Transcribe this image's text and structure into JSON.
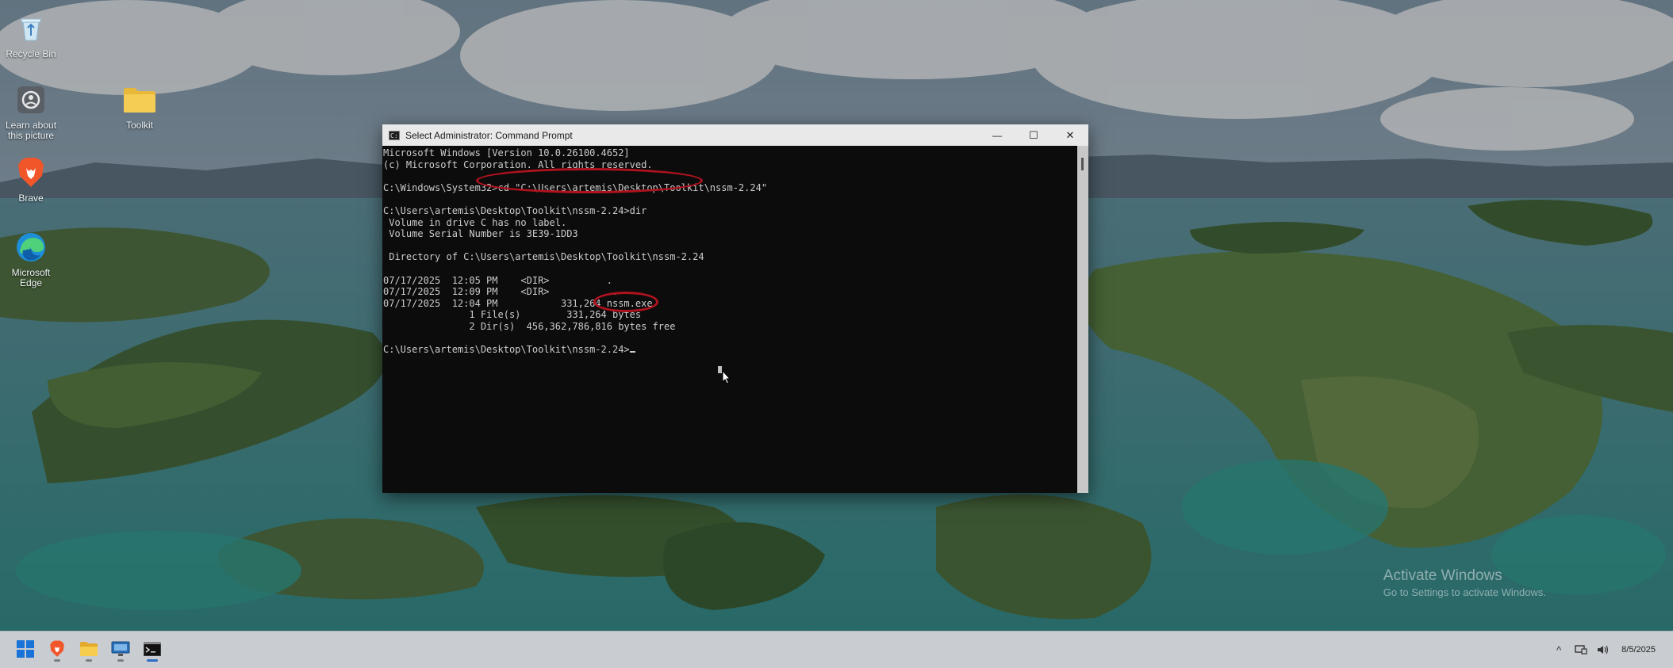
{
  "desktop": {
    "icons": [
      {
        "label": "Recycle Bin",
        "icon": "recycle-bin-icon"
      },
      {
        "label": "Learn about this picture",
        "icon": "learn-camera-icon"
      },
      {
        "label": "Toolkit",
        "icon": "folder-icon"
      },
      {
        "label": "Brave",
        "icon": "brave-lion-icon"
      },
      {
        "label": "Microsoft Edge",
        "icon": "edge-icon"
      }
    ],
    "watermark": {
      "line1": "Activate Windows",
      "line2": "Go to Settings to activate Windows."
    }
  },
  "cmd_window": {
    "title": "Select Administrator: Command Prompt",
    "controls": {
      "minimize": "—",
      "maximize": "☐",
      "close": "✕"
    },
    "lines": [
      "Microsoft Windows [Version 10.0.26100.4652]",
      "(c) Microsoft Corporation. All rights reserved.",
      "",
      "C:\\Windows\\System32>cd \"C:\\Users\\artemis\\Desktop\\Toolkit\\nssm-2.24\"",
      "",
      "C:\\Users\\artemis\\Desktop\\Toolkit\\nssm-2.24>dir",
      " Volume in drive C has no label.",
      " Volume Serial Number is 3E39-1DD3",
      "",
      " Directory of C:\\Users\\artemis\\Desktop\\Toolkit\\nssm-2.24",
      "",
      "07/17/2025  12:05 PM    <DIR>          .",
      "07/17/2025  12:09 PM    <DIR>          ..",
      "07/17/2025  12:04 PM           331,264 nssm.exe",
      "               1 File(s)        331,264 bytes",
      "               2 Dir(s)  456,362,786,816 bytes free",
      "",
      "C:\\Users\\artemis\\Desktop\\Toolkit\\nssm-2.24>"
    ]
  },
  "taskbar": {
    "apps": [
      {
        "name": "start",
        "icon": "windows-start-icon"
      },
      {
        "name": "brave",
        "icon": "brave-lion-icon"
      },
      {
        "name": "file-explorer",
        "icon": "file-explorer-icon"
      },
      {
        "name": "remote-desktop",
        "icon": "monitor-icon"
      },
      {
        "name": "command-prompt",
        "icon": "terminal-icon",
        "active": true
      }
    ],
    "tray": {
      "chevron": "^",
      "date": "8/5/2025"
    }
  },
  "colors": {
    "annotation": "#b0121e",
    "console_bg": "#0c0c0c",
    "console_text": "#cccccc",
    "titlebar": "#e9e9e9"
  }
}
